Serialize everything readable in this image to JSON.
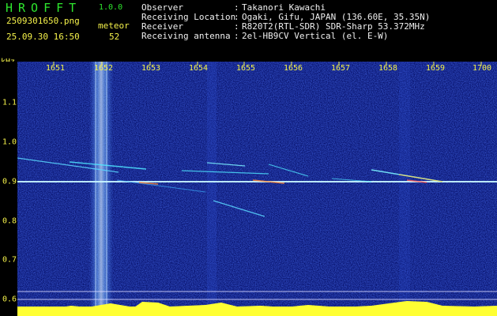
{
  "header": {
    "app_title": "HROFFT",
    "app_version": "1.0.0",
    "file_name": "2509301650.png",
    "meteor_label": "meteor",
    "datetime": "25.09.30 16:50",
    "meteor_count": "52",
    "info": [
      {
        "label": "Observer",
        "value": "Takanori Kawachi"
      },
      {
        "label": "Receiving Location",
        "value": "Ogaki, Gifu, JAPAN (136.60E, 35.35N)"
      },
      {
        "label": "Receiver",
        "value": "R820T2(RTL-SDR) SDR-Sharp 53.372MHz"
      },
      {
        "label": "Receiving antenna",
        "value": "2el-HB9CV Vertical (el. E-W)"
      }
    ]
  },
  "axes": {
    "y_unit": "kHz",
    "x_ticks": [
      "1651",
      "1652",
      "1653",
      "1654",
      "1655",
      "1656",
      "1657",
      "1658",
      "1659",
      "1700"
    ],
    "y_ticks": [
      "1.1",
      "1.0",
      "0.9",
      "0.8",
      "0.7",
      "0.6"
    ]
  },
  "colors": {
    "background": "#000000",
    "header_green": "#2ee62e",
    "tick_yellow": "#f5f24a",
    "noise_blue": "#0a1a8c",
    "signal_cyan": "#4fe6ff",
    "activity_yellow": "#ffff33"
  }
}
